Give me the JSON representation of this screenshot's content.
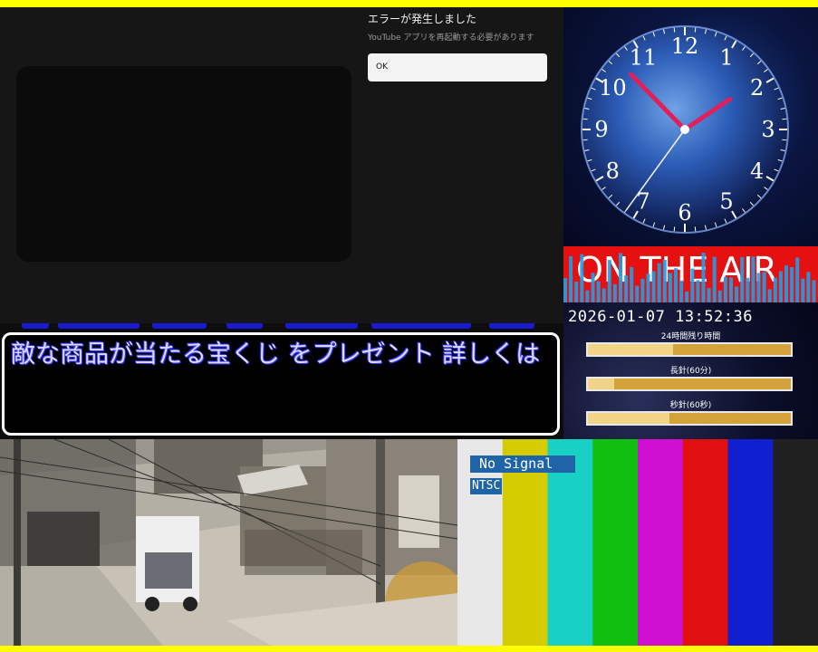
{
  "youtube_error": {
    "title": "エラーが発生しました",
    "message": "YouTube アプリを再起動する必要があります",
    "ok_label": "OK"
  },
  "subtitle": {
    "text": "敵な商品が当たる宝くじ をプレゼント 詳しくは"
  },
  "clock": {
    "numerals": [
      "12",
      "1",
      "2",
      "3",
      "4",
      "5",
      "6",
      "7",
      "8",
      "9",
      "10",
      "11"
    ],
    "hour": 1,
    "minute": 52,
    "second": 36
  },
  "onair": {
    "label": "ON THE AIR"
  },
  "status": {
    "datetime": "2026-01-07 13:52:36",
    "hours_label": "24時間残り時間",
    "minute_label": "長針(60分)",
    "second_label": "秒針(60秒)",
    "hours_remaining_fraction": 0.42,
    "minute_fraction": 0.13,
    "second_fraction": 0.4
  },
  "test_pattern": {
    "no_signal": "No Signal",
    "standard": "NTSC",
    "colors": [
      "#e8e8e8",
      "#d4cc00",
      "#18d0c4",
      "#10c010",
      "#d010d0",
      "#e01010",
      "#1020d0",
      "#202020"
    ]
  },
  "accent_colors": {
    "frame": "#ffff00",
    "subtitle_text": "#dcdcff",
    "onair_bg": "#e51010"
  }
}
